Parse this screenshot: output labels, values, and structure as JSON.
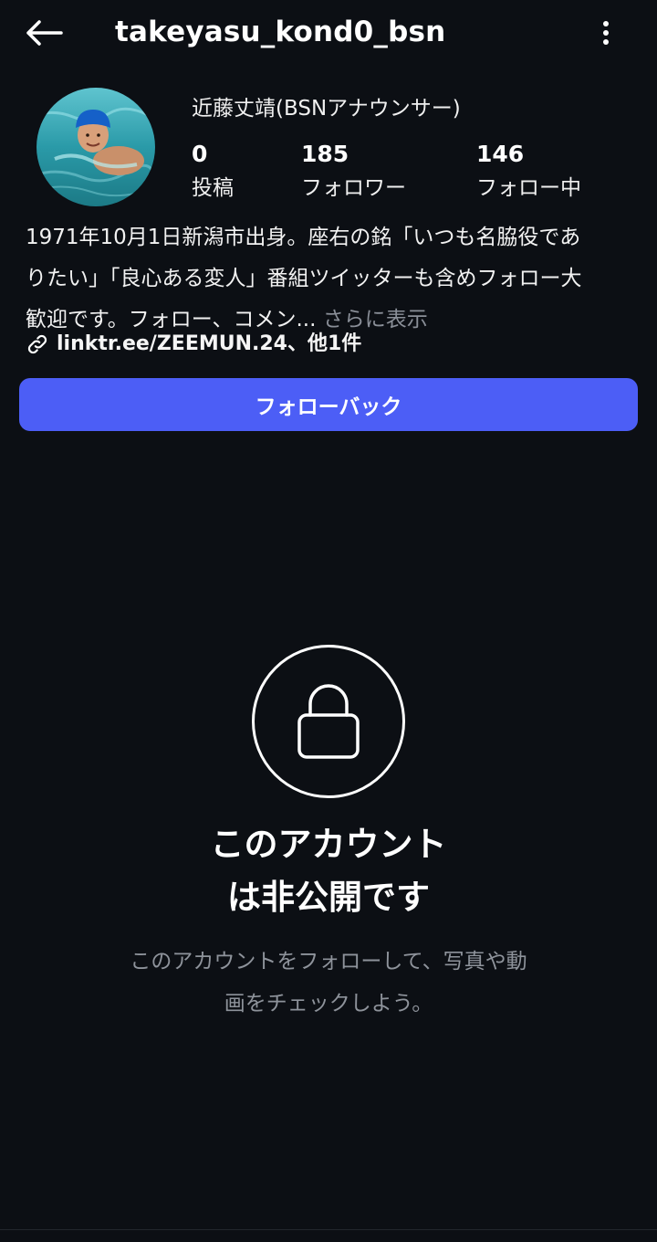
{
  "header": {
    "username": "takeyasu_kond0_bsn",
    "back_icon": "arrow-left-icon",
    "more_icon": "more-vertical-icon"
  },
  "profile": {
    "display_name": "近藤丈靖(BSNアナウンサー)",
    "stats": {
      "posts": {
        "count": "0",
        "label": "投稿"
      },
      "followers": {
        "count": "185",
        "label": "フォロワー"
      },
      "following": {
        "count": "146",
        "label": "フォロー中"
      }
    },
    "bio_lines": [
      "1971年10月1日新潟市出身。座右の銘「いつも名脇役であ",
      "りたい」「良心ある変人」番組ツイッターも含めフォロー大",
      "歓迎です。フォロー、コメン..."
    ],
    "bio_more": "さらに表示",
    "links_text": "linktr.ee/ZEEMUN.24、他1件"
  },
  "actions": {
    "follow_back_label": "フォローバック"
  },
  "private": {
    "title_lines": [
      "このアカウント",
      "は非公開です"
    ],
    "subtitle_lines": [
      "このアカウントをフォローして、写真や動",
      "画をチェックしよう。"
    ]
  },
  "colors": {
    "background": "#0c0f14",
    "primary_button": "#4c5ef6",
    "muted_text": "#8e939b"
  }
}
